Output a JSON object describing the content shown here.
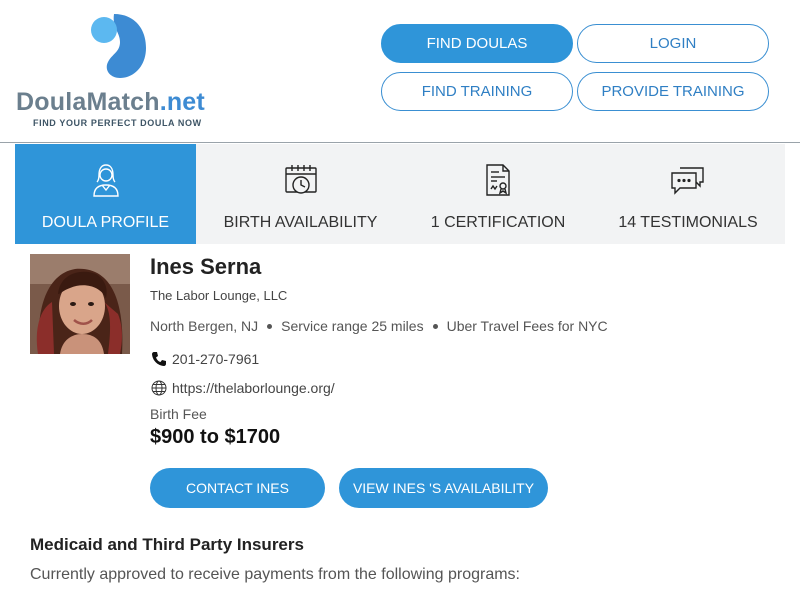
{
  "logo": {
    "name_part1": "DoulaMatch",
    "name_part2": ".net",
    "tagline": "FIND YOUR PERFECT DOULA NOW",
    "icon": "droplet-logo-icon",
    "colors": {
      "dark": "#6b7f8e",
      "accent": "#3d8bd3",
      "light": "#5cb8f0"
    }
  },
  "nav": {
    "find_doulas": "FIND DOULAS",
    "login": "LOGIN",
    "find_training": "FIND TRAINING",
    "provide_training": "PROVIDE TRAINING"
  },
  "tabs": [
    {
      "label": "DOULA PROFILE",
      "icon": "doula-person-icon",
      "active": true
    },
    {
      "label": "BIRTH AVAILABILITY",
      "icon": "calendar-clock-icon",
      "active": false
    },
    {
      "label": "1 CERTIFICATION",
      "icon": "certificate-document-icon",
      "active": false
    },
    {
      "label": "14 TESTIMONIALS",
      "icon": "chat-bubbles-icon",
      "active": false
    }
  ],
  "profile": {
    "name": "Ines Serna",
    "company": "The Labor Lounge, LLC",
    "location": "North Bergen, NJ",
    "service_range": "Service range 25 miles",
    "travel_fees": "Uber Travel Fees for NYC",
    "phone": "201-270-7961",
    "website": "https://thelaborlounge.org/",
    "fee_label": "Birth Fee",
    "fee_value": "$900 to $1700",
    "contact_button": "CONTACT INES",
    "availability_button": "VIEW INES 'S AVAILABILITY"
  },
  "insurance": {
    "title": "Medicaid and Third Party Insurers",
    "text": "Currently approved to receive payments from the following programs:"
  },
  "colors": {
    "primary": "#2f95d9",
    "tab_bg": "#f2f3f4"
  }
}
